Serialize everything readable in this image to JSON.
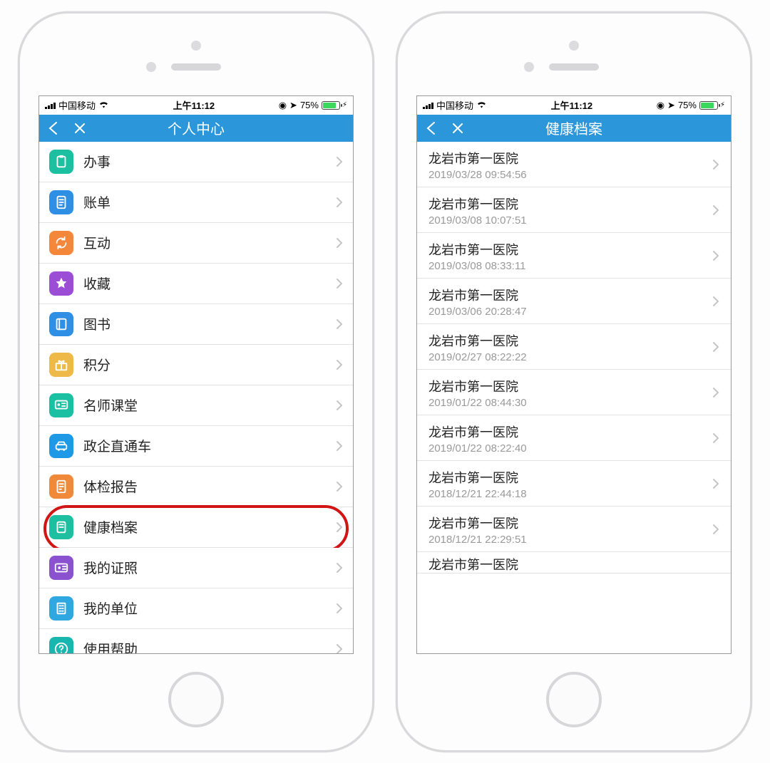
{
  "status": {
    "carrier": "中国移动",
    "time": "上午11:12",
    "battery_pct": "75%",
    "battery_fill_pct": 75
  },
  "phone1": {
    "title": "个人中心",
    "items": [
      {
        "label": "办事",
        "color": "c-green",
        "icon": "clipboard"
      },
      {
        "label": "账单",
        "color": "c-blue",
        "icon": "receipt"
      },
      {
        "label": "互动",
        "color": "c-orange",
        "icon": "refresh"
      },
      {
        "label": "收藏",
        "color": "c-purple",
        "icon": "star"
      },
      {
        "label": "图书",
        "color": "c-blue",
        "icon": "book"
      },
      {
        "label": "积分",
        "color": "c-gold",
        "icon": "gift"
      },
      {
        "label": "名师课堂",
        "color": "c-teal",
        "icon": "teacher"
      },
      {
        "label": "政企直通车",
        "color": "c-blue2",
        "icon": "car"
      },
      {
        "label": "体检报告",
        "color": "c-orange2",
        "icon": "report"
      },
      {
        "label": "健康档案",
        "color": "c-green",
        "icon": "folder",
        "highlight": true
      },
      {
        "label": "我的证照",
        "color": "c-violet",
        "icon": "idcard"
      },
      {
        "label": "我的单位",
        "color": "c-sky",
        "icon": "building"
      },
      {
        "label": "使用帮助",
        "color": "c-cyan",
        "icon": "help"
      }
    ]
  },
  "phone2": {
    "title": "健康档案",
    "records": [
      {
        "title": "龙岩市第一医院",
        "time": "2019/03/28 09:54:56"
      },
      {
        "title": "龙岩市第一医院",
        "time": "2019/03/08 10:07:51"
      },
      {
        "title": "龙岩市第一医院",
        "time": "2019/03/08 08:33:11"
      },
      {
        "title": "龙岩市第一医院",
        "time": "2019/03/06 20:28:47"
      },
      {
        "title": "龙岩市第一医院",
        "time": "2019/02/27 08:22:22"
      },
      {
        "title": "龙岩市第一医院",
        "time": "2019/01/22 08:44:30"
      },
      {
        "title": "龙岩市第一医院",
        "time": "2019/01/22 08:22:40"
      },
      {
        "title": "龙岩市第一医院",
        "time": "2018/12/21 22:44:18"
      },
      {
        "title": "龙岩市第一医院",
        "time": "2018/12/21 22:29:51"
      }
    ],
    "partial": "龙岩市第一医院"
  }
}
